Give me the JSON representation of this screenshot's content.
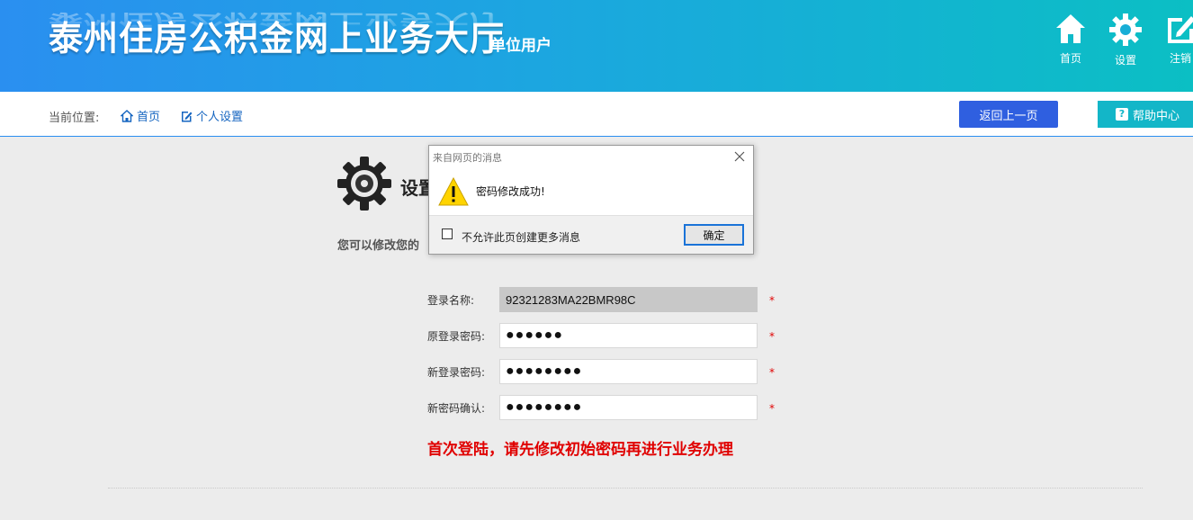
{
  "header": {
    "title": "泰州住房公积金网上业务大厅",
    "user_type": "单位用户",
    "buttons": [
      {
        "label": "首页",
        "icon": "home-icon"
      },
      {
        "label": "设置",
        "icon": "gear-icon"
      },
      {
        "label": "注销",
        "icon": "edit-icon"
      }
    ]
  },
  "breadcrumb": {
    "prefix": "当前位置:",
    "home": "首页",
    "current": "个人设置"
  },
  "actions": {
    "back": "返回上一页",
    "help": "帮助中心"
  },
  "section": {
    "title": "设置",
    "description": "您可以修改您的"
  },
  "form": {
    "fields": [
      {
        "label": "登录名称:",
        "value": "92321283MA22BMR98C"
      },
      {
        "label": "原登录密码:",
        "value": "●●●●●●"
      },
      {
        "label": "新登录密码:",
        "value": "●●●●●●●●"
      },
      {
        "label": "新密码确认:",
        "value": "●●●●●●●●"
      }
    ],
    "required_mark": "*",
    "notice": "首次登陆，请先修改初始密码再进行业务办理"
  },
  "dialog": {
    "title": "来自网页的消息",
    "message": "密码修改成功!",
    "checkbox_label": "不允许此页创建更多消息",
    "ok": "确定"
  },
  "colors": {
    "header_start": "#2a8ff0",
    "header_end": "#0bbfc4",
    "back_button": "#2f5fe0",
    "help_button": "#13b6c8",
    "warning_text": "#e00000"
  }
}
